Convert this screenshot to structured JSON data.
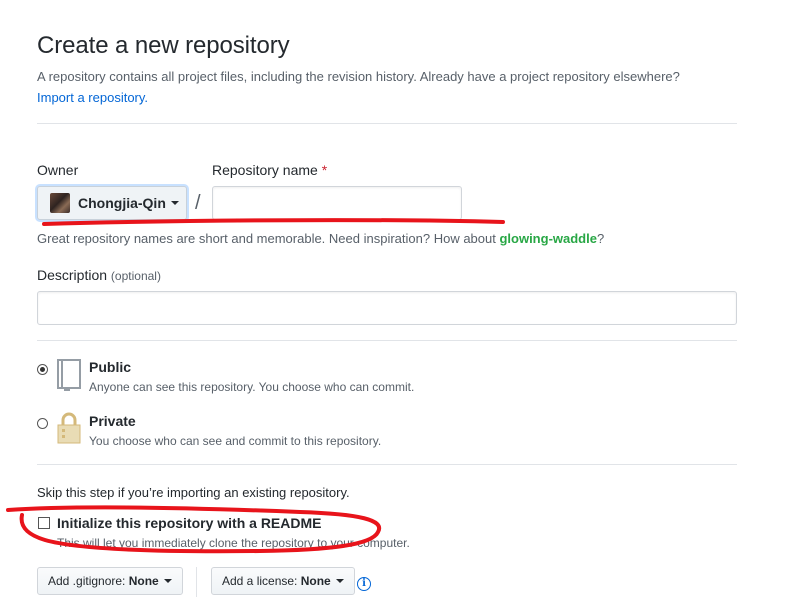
{
  "header": {
    "title": "Create a new repository",
    "subtitle": "A repository contains all project files, including the revision history. Already have a project repository elsewhere?",
    "import_link": "Import a repository."
  },
  "owner": {
    "label": "Owner",
    "selected": "Chongjia-Qin"
  },
  "repo_name": {
    "label": "Repository name",
    "required_mark": "*",
    "value": "",
    "hint_prefix": "Great repository names are short and memorable. Need inspiration? How about ",
    "suggestion": "glowing-waddle",
    "hint_suffix": "?"
  },
  "separator": "/",
  "description": {
    "label": "Description",
    "optional": "(optional)",
    "value": ""
  },
  "visibility": {
    "selected": "public",
    "public": {
      "title": "Public",
      "desc": "Anyone can see this repository. You choose who can commit.",
      "icon": "repo-book-icon"
    },
    "private": {
      "title": "Private",
      "desc": "You choose who can see and commit to this repository.",
      "icon": "lock-icon"
    }
  },
  "init": {
    "skip_note": "Skip this step if you’re importing an existing repository.",
    "readme_label": "Initialize this repository with a README",
    "readme_checked": false,
    "readme_desc": "This will let you immediately clone the repository to your computer."
  },
  "extras": {
    "gitignore_prefix": "Add .gitignore:",
    "gitignore_value": "None",
    "license_prefix": "Add a license:",
    "license_value": "None",
    "info_icon": "info-icon"
  },
  "annotations": {
    "color": "#e8141b"
  },
  "colors": {
    "link": "#0366d6",
    "suggestion": "#28a745",
    "required": "#cb2431"
  }
}
